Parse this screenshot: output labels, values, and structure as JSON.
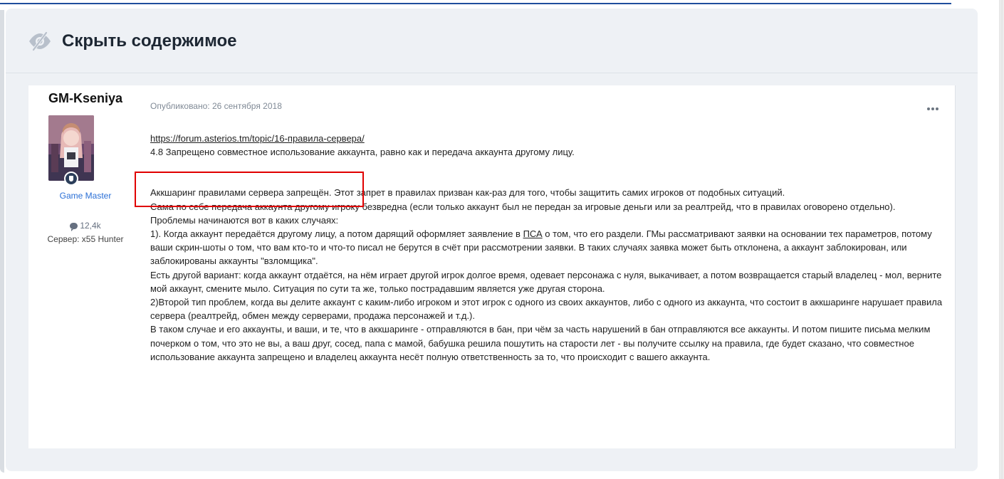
{
  "spoiler": {
    "title": "Скрыть содержимое",
    "icon": "eye-slash-icon"
  },
  "post": {
    "author": "GM-Kseniya",
    "group": "Game Master",
    "post_count": "12,4k",
    "server": "Сервер: x55 Hunter",
    "date": "Опубликовано: 26 сентября 2018",
    "link": "https://forum.asterios.tm/topic/16-правила-сервера/",
    "rule_line": "4.8 Запрещено совместное использование аккаунта, равно как и передача аккаунта другому лицу.",
    "para1": "Аккшаринг правилами сервера запрещён. Этот запрет в правилах призван как-раз для того, чтобы защитить самих игроков от подобных ситуаций.",
    "para2": "Сама по себе передача аккаунта другому игроку безвредна (если только аккаунт был не передан за игровые деньги или за реалтрейд, что в правилах оговорено отдельно).",
    "para3": "Проблемы начинаются вот в каких случаях:",
    "para4_prefix": "1). Когда аккаунт передаётся другому лицу, а потом дарящий оформляет заявление в ",
    "para4_abbr": "ПСА",
    "para4_suffix": " о том, что его раздели. ГМы рассматривают заявки на основании тех параметров, потому ваши скрин-шоты о том, что вам кто-то и что-то писал не берутся в счёт при рассмотрении заявки. В таких случаях заявка может быть отклонена, а аккаунт заблокирован, или заблокированы аккаунты \"взломщика\".",
    "para5": "Есть другой вариант: когда аккаунт отдаётся, на нём играет другой игрок долгое время, одевает персонажа с нуля, выкачивает, а потом возвращается старый владелец - мол, верните мой аккаунт, смените мыло. Ситуация по сути та же, только пострадавшим является уже другая сторона.",
    "para6": "2)Второй тип проблем, когда вы делите аккаунт с каким-либо игроком и этот игрок с одного из своих аккаунтов, либо с одного из аккаунта, что состоит в аккшаринге нарушает правила сервера (реалтрейд, обмен между серверами, продажа персонажей и т.д.).",
    "para7": "В таком случае и его аккаунты, и ваши, и те, что в аккшаринге - отправляются в бан, при чём за часть нарушений в бан отправляются все аккаунты. И потом пишите письма мелким почерком о том, что это не вы, а ваш друг, сосед, папа с мамой, бабушка решила пошутить на старости лет - вы получите ссылку на правила, где будет сказано, что совместное использование аккаунта запрещено и владелец аккаунта несёт полную ответственность за то, что происходит с вашего аккаунта."
  },
  "colors": {
    "spoiler_bg": "#eef1f5",
    "group_color": "#2a6fd6",
    "highlight_border": "#e00000"
  }
}
